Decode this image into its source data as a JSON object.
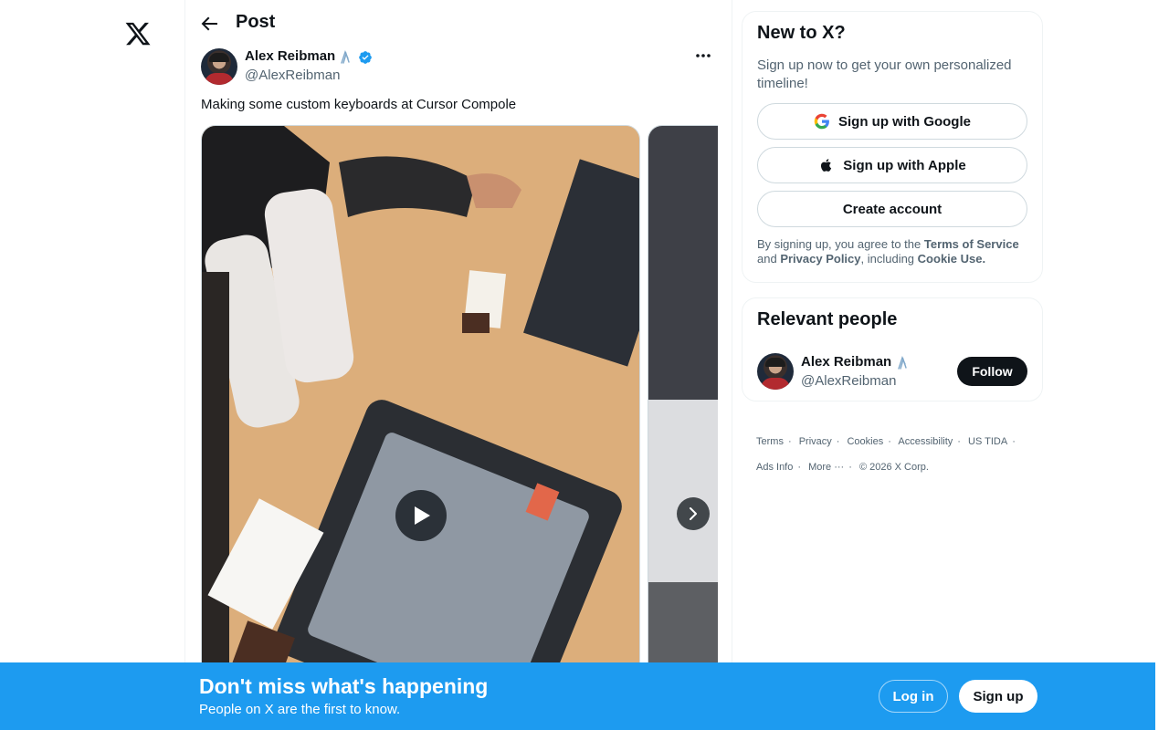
{
  "header": {
    "title": "Post"
  },
  "post": {
    "author_name": "Alex Reibman",
    "author_emoji": "🖇️",
    "author_handle": "@AlexReibman",
    "text": "Making some custom keyboards at Cursor Compole"
  },
  "signup_card": {
    "title": "New to X?",
    "subtitle": "Sign up now to get your own personalized timeline!",
    "google_label": "Sign up with Google",
    "apple_label": "Sign up with Apple",
    "create_label": "Create account",
    "legal_prefix": "By signing up, you agree to the",
    "terms_label": "Terms of Service",
    "legal_and": "and",
    "privacy_label": "Privacy Policy",
    "legal_including": ", including",
    "cookie_label": "Cookie Use."
  },
  "relevant_people": {
    "title": "Relevant people",
    "name": "Alex Reibman",
    "handle": "@AlexReibman",
    "follow_label": "Follow"
  },
  "footer": {
    "links": [
      "Terms",
      "Privacy",
      "Cookies",
      "Accessibility",
      "US TIDA",
      "Ads Info",
      "More ···"
    ],
    "copyright": "© 2026 X Corp."
  },
  "banner": {
    "title": "Don't miss what's happening",
    "subtitle": "People on X are the first to know.",
    "login_label": "Log in",
    "signup_label": "Sign up"
  },
  "colors": {
    "accent": "#1d9bf0",
    "verified": "#1d9bf0",
    "text": "#0f1419",
    "muted": "#536471"
  }
}
